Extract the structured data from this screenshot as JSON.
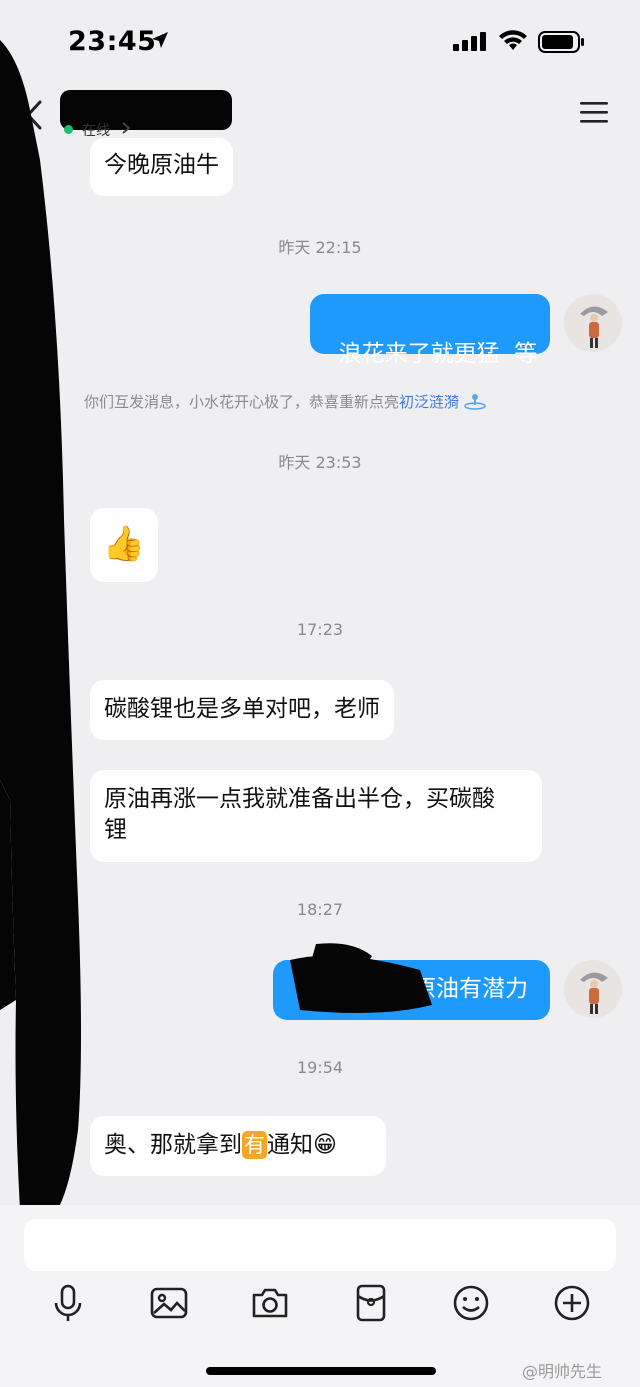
{
  "status_bar": {
    "time": "23:45"
  },
  "header": {
    "contact_name": "██████",
    "status": "在线"
  },
  "messages": [
    {
      "text": "今晚原油牛"
    },
    {
      "time": "昨天 22:15"
    },
    {
      "text": "浪花来了就更猛  等"
    },
    {
      "system": "你们互发消息，小水花开心极了，恭喜重新点亮",
      "link": "初泛涟漪"
    },
    {
      "time": "昨天 23:53"
    },
    {
      "emoji": "👍"
    },
    {
      "time": "17:23"
    },
    {
      "text": "碳酸锂也是多单对吧，老师"
    },
    {
      "text_line1": "原油再涨一点我就准备出半仓，买碳酸",
      "text_line2": "锂"
    },
    {
      "time": "18:27"
    },
    {
      "text": "原油有潜力"
    },
    {
      "time": "19:54"
    },
    {
      "text_a": "奥、那就拿到",
      "badge": "有",
      "text_b": "通知",
      "emoji": "😁"
    }
  ],
  "input": {
    "placeholder": ""
  },
  "toolbar": {
    "items": [
      "mic-icon",
      "image-icon",
      "camera-icon",
      "red-packet-icon",
      "emoji-icon",
      "plus-icon"
    ]
  },
  "watermark": "@明帅先生",
  "colors": {
    "sent_bubble": "#1e9afc",
    "received_bubble": "#ffffff",
    "background": "#efeff1",
    "link": "#3d7bd9"
  }
}
